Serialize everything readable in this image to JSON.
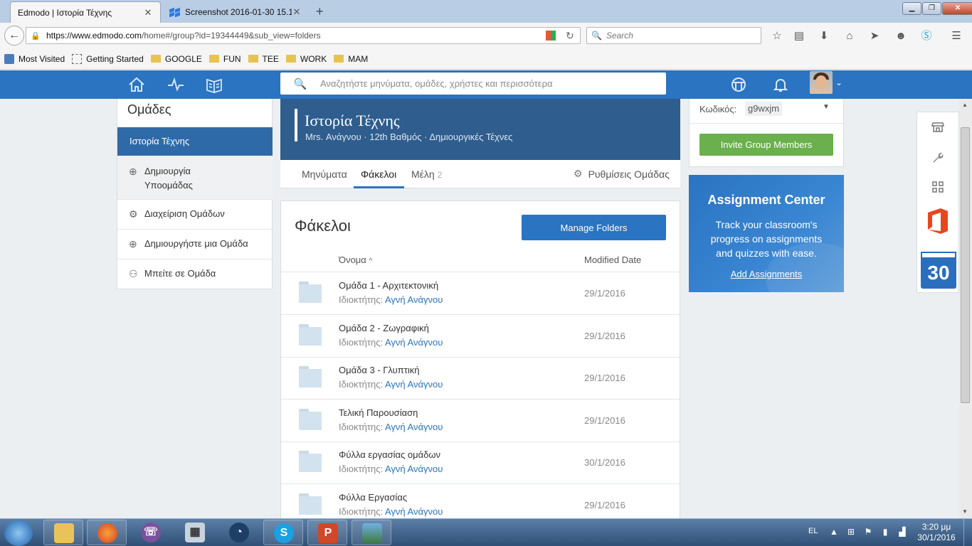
{
  "browser": {
    "tabs": [
      {
        "title": "Edmodo | Ιστορία Τέχνης",
        "close": "✕"
      },
      {
        "title": "Screenshot 2016-01-30 15.1...",
        "close": "✕"
      }
    ],
    "new_tab": "+",
    "url_host": "https://www.edmodo.com",
    "url_path": "/home#/group?id=19344449&sub_view=folders",
    "search_placeholder": "Search",
    "bookmarks": [
      "Most Visited",
      "Getting Started",
      "GOOGLE",
      "FUN",
      "TEE",
      "WORK",
      "MAM"
    ]
  },
  "header": {
    "search_placeholder": "Αναζητήστε μηνύματα, ομάδες, χρήστες και περισσότερα"
  },
  "left_panel": {
    "title": "Ομάδες",
    "active_group": "Ιστορία Τέχνης",
    "create_subgroup_line1": "Δημιουργία",
    "create_subgroup_line2": "Υποομάδας",
    "manage_groups": "Διαχείριση Ομάδων",
    "create_group": "Δημιουργήστε μια Ομάδα",
    "join_group": "Μπείτε σε Ομάδα"
  },
  "group": {
    "title": "Ιστορία Τέχνης",
    "subtitle": "Mrs. Ανάγνου · 12th Βαθμός · Δημιουργικές Τέχνες",
    "tabs": {
      "posts": "Μηνύματα",
      "folders": "Φάκελοι",
      "members": "Μέλη",
      "members_count": "2",
      "settings": "Ρυθμίσεις Ομάδας"
    }
  },
  "folders": {
    "title": "Φάκελοι",
    "manage_button": "Manage Folders",
    "col_name": "Όνομα",
    "col_sort": "^",
    "col_date": "Modified Date",
    "owner_label": "Ιδιοκτήτης:",
    "rows": [
      {
        "name": "Ομάδα 1 - Αρχιτεκτονική",
        "owner": "Αγνή Ανάγνου",
        "date": "29/1/2016"
      },
      {
        "name": "Ομάδα 2 - Ζωγραφική",
        "owner": "Αγνή Ανάγνου",
        "date": "29/1/2016"
      },
      {
        "name": "Ομάδα 3 - Γλυπτική",
        "owner": "Αγνή Ανάγνου",
        "date": "29/1/2016"
      },
      {
        "name": "Τελική Παρουσίαση",
        "owner": "Αγνή Ανάγνου",
        "date": "29/1/2016"
      },
      {
        "name": "Φύλλα εργασίας ομάδων",
        "owner": "Αγνή Ανάγνου",
        "date": "30/1/2016"
      },
      {
        "name": "Φύλλα Εργασίας",
        "owner": "Αγνή Ανάγνου",
        "date": "29/1/2016"
      }
    ]
  },
  "right_panel": {
    "code_label": "Κωδικός:",
    "code_value": "g9wxjm",
    "invite_button": "Invite Group Members",
    "assignment_center": {
      "title": "Assignment Center",
      "body": "Track your classroom's progress on assignments and quizzes with ease.",
      "link": "Add Assignments"
    },
    "calendar_day": "30"
  },
  "taskbar": {
    "language": "EL",
    "time": "3:20 μμ",
    "date": "30/1/2016"
  },
  "colors": {
    "edmodo_blue": "#2a74c1",
    "banner_blue": "#2e5d8e",
    "invite_green": "#6ab04c"
  }
}
